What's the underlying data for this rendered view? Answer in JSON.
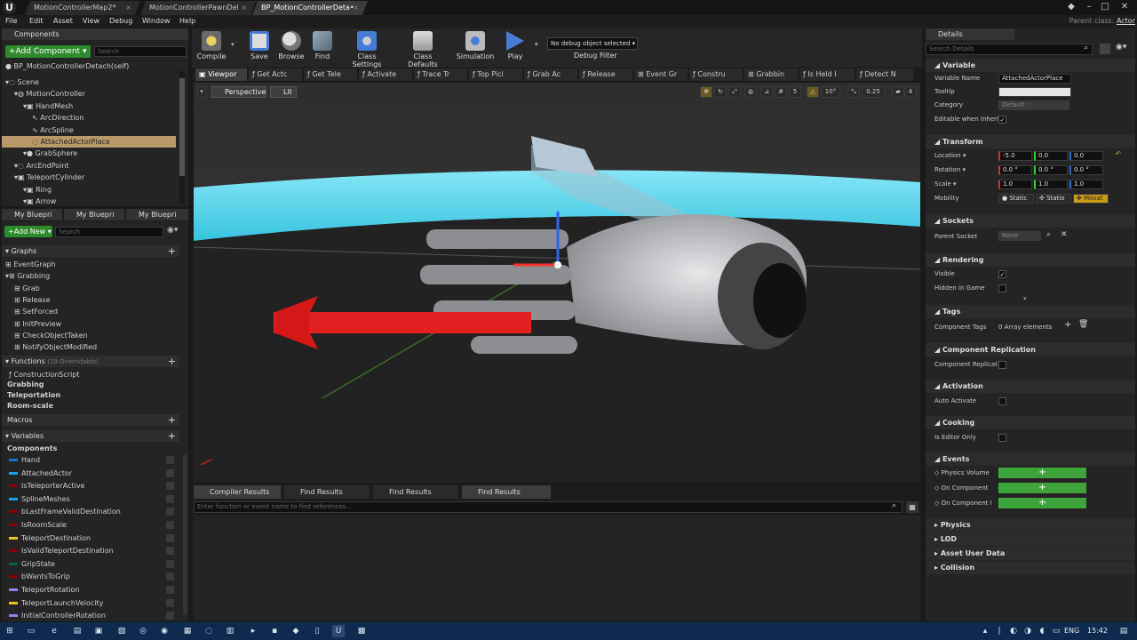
{
  "titlebar": {
    "tabs": [
      {
        "label": "MotionControllerMap2*",
        "active": false
      },
      {
        "label": "MotionControllerPawnDel",
        "active": false
      },
      {
        "label": "BP_MotionControllerDeta•",
        "active": true
      }
    ],
    "parent_class_label": "Parent class:",
    "parent_class_value": "Actor"
  },
  "menu": [
    "File",
    "Edit",
    "Asset",
    "View",
    "Debug",
    "Window",
    "Help"
  ],
  "components_panel": {
    "tab_label": "Components",
    "add_button": "+Add Component ▾",
    "search_placeholder": "Search",
    "self_label": "BP_MotionControllerDetach(self)",
    "tree": [
      {
        "label": "Scene",
        "depth": 0,
        "icon": "scene-icon"
      },
      {
        "label": "MotionController",
        "depth": 1,
        "icon": "controller-icon"
      },
      {
        "label": "HandMesh",
        "depth": 2,
        "icon": "mesh-icon"
      },
      {
        "label": "ArcDirection",
        "depth": 3,
        "icon": "arrow-icon"
      },
      {
        "label": "ArcSpline",
        "depth": 3,
        "icon": "spline-icon"
      },
      {
        "label": "AttachedActorPlace",
        "depth": 3,
        "icon": "scene-icon",
        "selected": true
      },
      {
        "label": "GrabSphere",
        "depth": 2,
        "icon": "sphere-icon"
      },
      {
        "label": "ArcEndPoint",
        "depth": 1,
        "icon": "scene-icon"
      },
      {
        "label": "TeleportCylinder",
        "depth": 1,
        "icon": "mesh-icon"
      },
      {
        "label": "Ring",
        "depth": 2,
        "icon": "mesh-icon"
      },
      {
        "label": "Arrow",
        "depth": 2,
        "icon": "mesh-icon"
      }
    ]
  },
  "myblueprint_panel": {
    "tabs": [
      "My Bluepri",
      "My Bluepri",
      "My Bluepri"
    ],
    "add_new": "+Add New ▾",
    "search_placeholder": "Search",
    "graphs_header": "Graphs",
    "graphs": [
      "EventGraph",
      "Grabbing"
    ],
    "grabbing_items": [
      "Grab",
      "Release",
      "SetForced",
      "InitPreview",
      "CheckObjectTaken",
      "NotifyObjectModified"
    ],
    "functions_header": "Functions",
    "functions_overridable": "(19 Overridable)",
    "functions": [
      "ConstructionScript",
      "Grabbing",
      "Teleportation",
      "Room-scale"
    ],
    "macros_header": "Macros",
    "variables_header": "Variables",
    "components_header": "Components",
    "variables": [
      {
        "label": "Hand",
        "color": "#1a6fd4"
      },
      {
        "label": "AttachedActor",
        "color": "#1a9ef0"
      },
      {
        "label": "IsTeleporterActive",
        "color": "#8b0000"
      },
      {
        "label": "SplineMeshes",
        "color": "#1a9ef0"
      },
      {
        "label": "bLastFrameValidDestination",
        "color": "#8b0000"
      },
      {
        "label": "IsRoomScale",
        "color": "#8b0000"
      },
      {
        "label": "TeleportDestination",
        "color": "#e8c21a"
      },
      {
        "label": "IsValidTeleportDestination",
        "color": "#8b0000"
      },
      {
        "label": "GripState",
        "color": "#0b5e4a"
      },
      {
        "label": "bWantsToGrip",
        "color": "#8b0000"
      },
      {
        "label": "TeleportRotation",
        "color": "#9b7fe8"
      },
      {
        "label": "TeleportLaunchVelocity",
        "color": "#e8c21a"
      },
      {
        "label": "InitialControllerRotation",
        "color": "#9b7fe8"
      }
    ]
  },
  "toolbar": {
    "buttons": [
      {
        "label": "Compile",
        "icon": "compile-icon"
      },
      {
        "label": "Save",
        "icon": "save-icon"
      },
      {
        "label": "Browse",
        "icon": "browse-icon"
      },
      {
        "label": "Find",
        "icon": "find-icon"
      },
      {
        "label": "Class Settings",
        "icon": "class-settings-icon"
      },
      {
        "label": "Class Defaults",
        "icon": "class-defaults-icon"
      },
      {
        "label": "Simulation",
        "icon": "simulation-icon"
      },
      {
        "label": "Play",
        "icon": "play-icon"
      }
    ],
    "debug_select": "No debug object selected ▾",
    "debug_filter": "Debug Filter"
  },
  "graph_tabs": [
    "Viewpor",
    "Get Actc",
    "Get Tele",
    "Activate",
    "Trace Tr",
    "Top Picl",
    "Grab Ac",
    "Release",
    "Event Gr",
    "Constru",
    "Grabbin",
    "Is Held I",
    "Detect N"
  ],
  "viewport": {
    "perspective": "Perspective",
    "lit": "Lit",
    "grid_snap": "5",
    "rot_snap": "10°",
    "scale_snap": "0.25",
    "cam_speed": "4"
  },
  "bottom_panel": {
    "tabs": [
      "Compiler Results",
      "Find Results",
      "Find Results",
      "Find Results"
    ],
    "search_placeholder": "Enter function or event name to find references..."
  },
  "details": {
    "tab_label": "Details",
    "search_placeholder": "Search Details",
    "variable": {
      "header": "Variable",
      "name_label": "Variable Name",
      "name_value": "AttachedActorPlace",
      "tooltip_label": "Tooltip",
      "category_label": "Category",
      "category_value": "Default",
      "editable_label": "Editable when Inherit"
    },
    "transform": {
      "header": "Transform",
      "location_label": "Location ▾",
      "location": [
        "-5.0",
        "0.0",
        "0.0"
      ],
      "rotation_label": "Rotation ▾",
      "rotation": [
        "0.0 °",
        "0.0 °",
        "0.0 °"
      ],
      "scale_label": "Scale ▾",
      "scale": [
        "1.0",
        "1.0",
        "1.0"
      ],
      "mobility_label": "Mobility",
      "mobility_options": [
        "Static",
        "Statio",
        "Movat"
      ]
    },
    "sockets": {
      "header": "Sockets",
      "parent_label": "Parent Socket",
      "parent_value": "None"
    },
    "rendering": {
      "header": "Rendering",
      "visible_label": "Visible",
      "hidden_label": "Hidden in Game"
    },
    "tags": {
      "header": "Tags",
      "label": "Component Tags",
      "value": "0 Array elements"
    },
    "replication": {
      "header": "Component Replication",
      "label": "Component Replicat"
    },
    "activation": {
      "header": "Activation",
      "label": "Auto Activate"
    },
    "cooking": {
      "header": "Cooking",
      "label": "Is Editor Only"
    },
    "events": {
      "header": "Events",
      "items": [
        "Physics Volume",
        "On Component",
        "On Component I"
      ]
    },
    "collapsed": [
      "Physics",
      "LOD",
      "Asset User Data",
      "Collision"
    ]
  },
  "taskbar": {
    "lang": "ENG",
    "time": "15:42"
  }
}
